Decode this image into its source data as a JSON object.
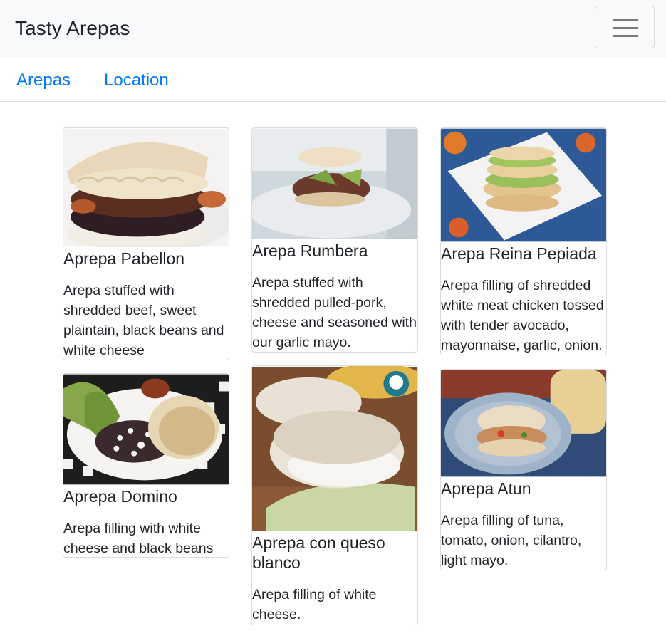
{
  "navbar": {
    "brand": "Tasty Arepas",
    "toggler_icon": "hamburger-menu-icon"
  },
  "nav": {
    "tabs": [
      {
        "label": "Arepas"
      },
      {
        "label": "Location"
      }
    ]
  },
  "cards": [
    {
      "title": "Aprepa Pabellon",
      "description": "Arepa stuffed with shredded beef, sweet plaintain, black beans and white cheese",
      "image": "arepa-pabellon-photo"
    },
    {
      "title": "Arepa Rumbera",
      "description": "Arepa stuffed with shredded pulled-pork, cheese and seasoned with our garlic mayo.",
      "image": "arepa-rumbera-photo"
    },
    {
      "title": "Arepa Reina Pepiada",
      "description": "Arepa filling of shredded white meat chicken tossed with tender avocado, mayonnaise, garlic, onion.",
      "image": "arepa-reina-pepiada-photo"
    },
    {
      "title": "Aprepa Domino",
      "description": "Arepa filling with white cheese and black beans",
      "image": "arepa-domino-photo"
    },
    {
      "title": "Aprepa con queso blanco",
      "description": "Arepa filling of white cheese.",
      "image": "arepa-queso-blanco-photo"
    },
    {
      "title": "Aprepa Atun",
      "description": "Arepa filling of tuna, tomato, onion, cilantro, light mayo.",
      "image": "arepa-atun-photo"
    }
  ],
  "colors": {
    "link": "#007bff",
    "navbar_bg": "#f8f9fa",
    "text": "#212529"
  }
}
